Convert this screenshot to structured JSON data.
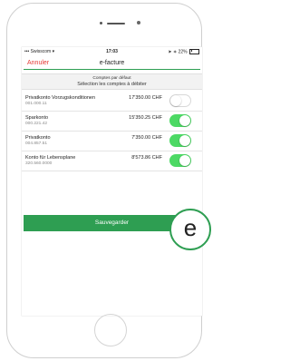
{
  "status_bar": {
    "carrier": "Swisscom",
    "time": "17:03",
    "battery": "22%"
  },
  "nav": {
    "cancel_label": "Annuler",
    "title": "e-facture"
  },
  "info": {
    "line1": "Comptes par défaut",
    "line2": "Sélection les comptes à débiter"
  },
  "accounts": [
    {
      "name": "Privatkonto Vorzugskonditionen",
      "iban": "001.000.11",
      "amount": "17'350.00 CHF",
      "enabled": false
    },
    {
      "name": "Sparkonto",
      "iban": "000.221.42",
      "amount": "15'350.25 CHF",
      "enabled": true
    },
    {
      "name": "Privatkonto",
      "iban": "004.857.51",
      "amount": "7'350.00 CHF",
      "enabled": true
    },
    {
      "name": "Konto für Lebensplane",
      "iban": "320.560.0000",
      "amount": "8'573.86 CHF",
      "enabled": true
    }
  ],
  "actions": {
    "save_label": "Sauvegarder"
  },
  "badge": {
    "letter": "e"
  },
  "colors": {
    "brand_green": "#2e9e52",
    "toggle_on": "#4cd964",
    "cancel_red": "#e53935"
  }
}
